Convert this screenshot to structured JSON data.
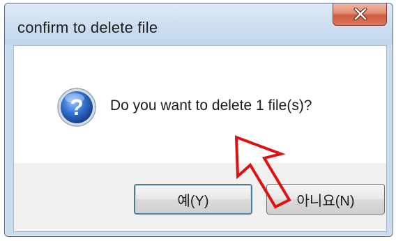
{
  "window": {
    "title": "confirm to delete file"
  },
  "message": {
    "text": "Do you want to delete 1 file(s)?",
    "icon": "question-icon"
  },
  "buttons": {
    "yes_label": "예(Y)",
    "no_label": "아니요(N)"
  },
  "colors": {
    "titlebar": "#cfe0f1",
    "close_button": "#d97a61",
    "annotation_arrow": "#e01010",
    "question_icon": "#2f6fcf"
  }
}
